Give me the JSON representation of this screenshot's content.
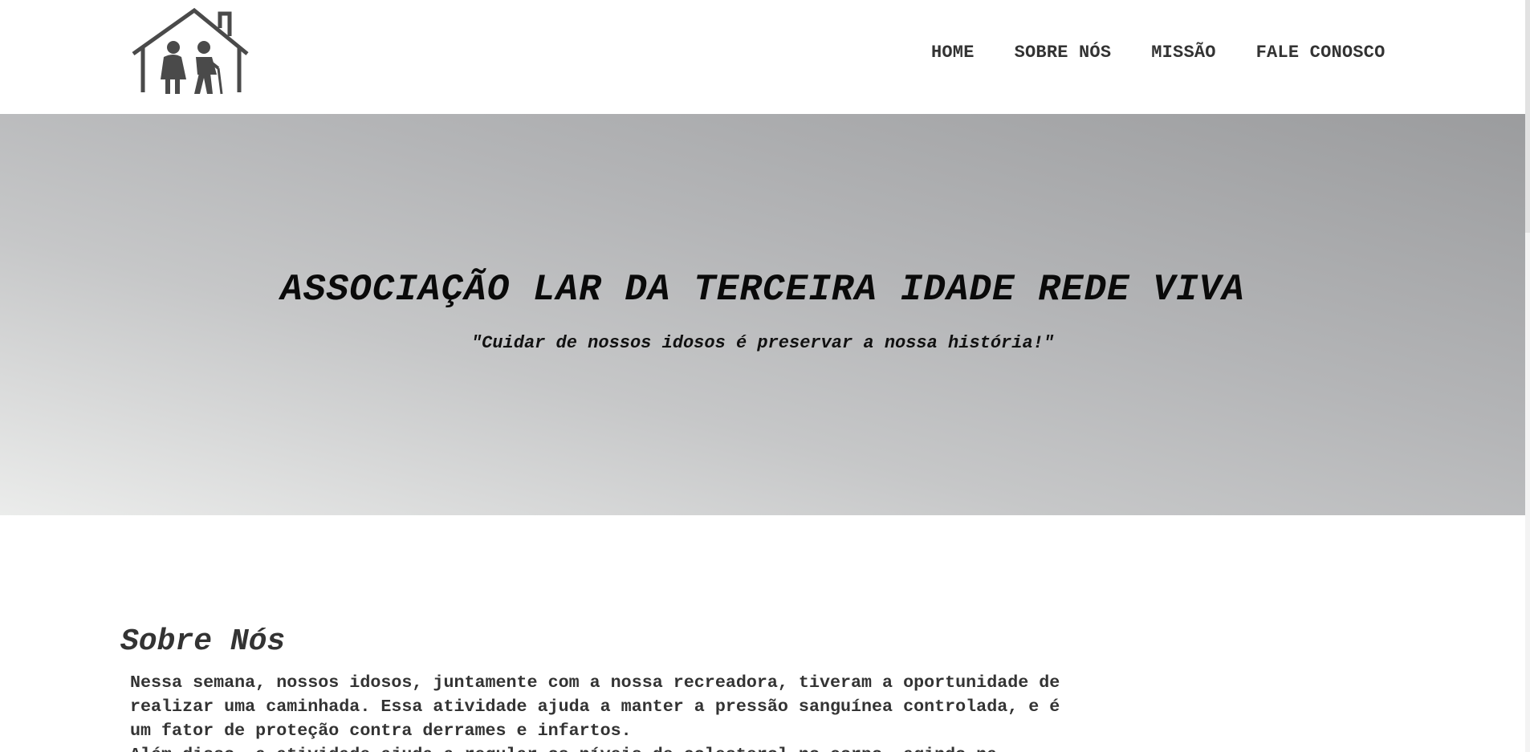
{
  "header": {
    "logo_alt": "Lar da Terceira Idade",
    "nav": [
      {
        "label": "HOME"
      },
      {
        "label": "SOBRE NÓS"
      },
      {
        "label": "MISSÃO"
      },
      {
        "label": "FALE CONOSCO"
      }
    ]
  },
  "hero": {
    "title": "ASSOCIAÇÃO LAR DA TERCEIRA IDADE REDE VIVA",
    "subtitle": "\"Cuidar de nossos idosos é preservar a nossa história!\""
  },
  "about": {
    "title": "Sobre Nós",
    "paragraphs": [
      "Nessa semana, nossos idosos, juntamente com a nossa recreadora, tiveram a oportunidade de\nrealizar uma caminhada. Essa atividade ajuda a manter a pressão sanguínea controlada, e é\num fator de proteção contra derrames e infartos.",
      "Além disso, a atividade ajuda a regular os níveis de colesterol no corpo, agindo na"
    ]
  },
  "colors": {
    "nav_text": "#333333",
    "hero_gradient_light": "#ebeceb",
    "hero_gradient_dark": "#9b9c9e",
    "logo_gray": "#4a4a4a"
  },
  "icons": {
    "logo": "house-with-elderly-couple-icon"
  }
}
